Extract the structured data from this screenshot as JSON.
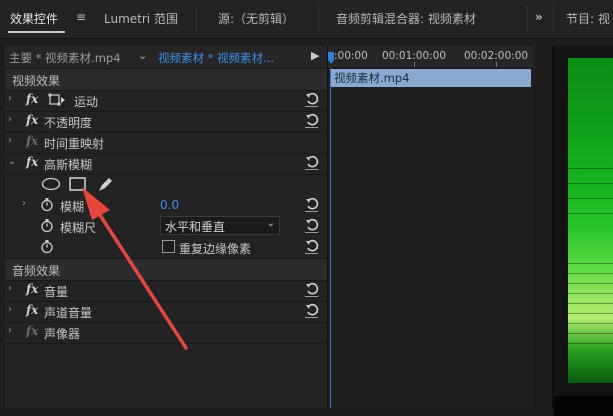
{
  "tabs": {
    "effect_controls": "效果控件",
    "effect_controls_menu": "≡",
    "lumetri": "Lumetri 范围",
    "source": "源:（无剪辑）",
    "audio_mixer": "音频剪辑混合器: 视频素材",
    "overflow": "»",
    "program": "节目: 视"
  },
  "clip_header": {
    "master": "主要 * 视频素材.mp4",
    "sequence": "视频素材 * 视频素材...",
    "chevron": "⌄",
    "play": "▶"
  },
  "sections": {
    "video_effects": "视频效果",
    "audio_effects": "音频效果"
  },
  "effects": {
    "fx_symbol": "fx",
    "motion": "运动",
    "opacity": "不透明度",
    "time_remap": "时间重映射",
    "gaussian_blur": "高斯模糊",
    "volume": "音量",
    "channel_volume": "声道音量",
    "panner": "声像器"
  },
  "blur": {
    "blurriness_label": "模糊",
    "blurriness_value": "0.0",
    "dimension_label": "模糊尺",
    "dimension_value": "水平和垂直",
    "repeat_edge_label": "重复边缘像素"
  },
  "timeline": {
    "timecodes": [
      ":00:00",
      "00:01:00:00",
      "00:02:00:00"
    ],
    "clip_name": "视频素材.mp4"
  },
  "colors": {
    "accent_blue": "#3a8fe6",
    "arrow_red": "#e8453c",
    "clip_bar": "#8aa9d0"
  },
  "icons": {
    "reset": "reset-icon",
    "stopwatch": "stopwatch-icon",
    "ellipse_mask": "ellipse-mask-icon",
    "rectangle_mask": "rectangle-mask-icon",
    "pen_mask": "pen-mask-icon"
  }
}
